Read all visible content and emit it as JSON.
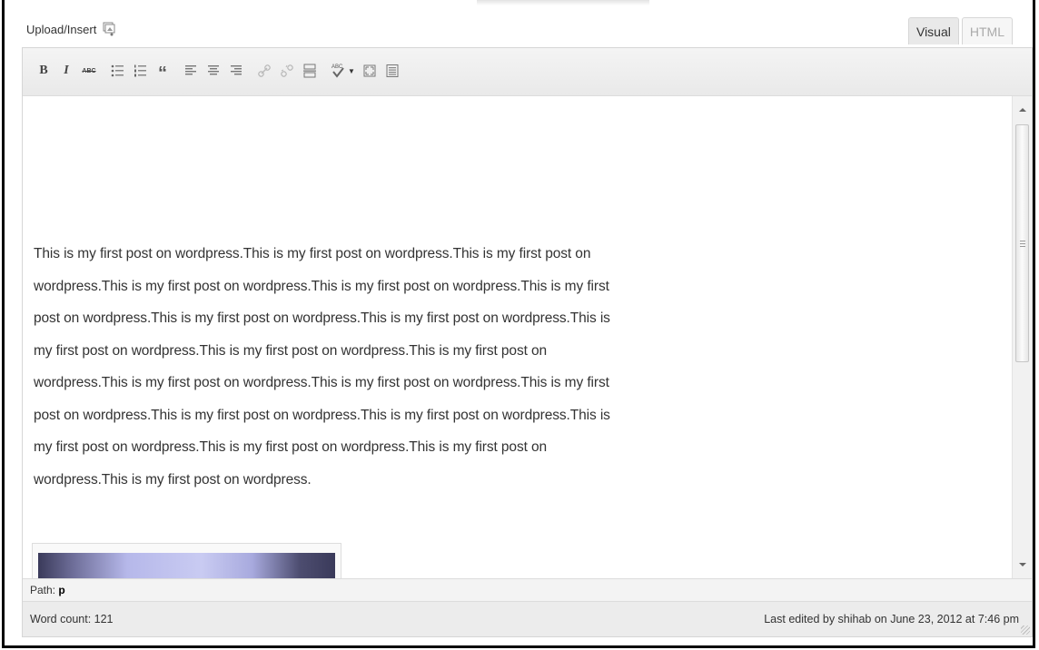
{
  "upload": {
    "label": "Upload/Insert",
    "icon": "media-gallery-icon"
  },
  "tabs": [
    {
      "label": "Visual",
      "active": true
    },
    {
      "label": "HTML",
      "active": false
    }
  ],
  "toolbar": {
    "buttons": [
      {
        "name": "bold-button",
        "label": "B"
      },
      {
        "name": "italic-button",
        "label": "I"
      },
      {
        "name": "strikethrough-button",
        "label": "ABC"
      },
      {
        "name": "bullet-list-button",
        "label": ""
      },
      {
        "name": "numbered-list-button",
        "label": ""
      },
      {
        "name": "blockquote-button",
        "label": "“"
      },
      {
        "name": "align-left-button",
        "label": ""
      },
      {
        "name": "align-center-button",
        "label": ""
      },
      {
        "name": "align-right-button",
        "label": ""
      },
      {
        "name": "insert-link-button",
        "label": ""
      },
      {
        "name": "unlink-button",
        "label": ""
      },
      {
        "name": "insert-more-tag-button",
        "label": ""
      },
      {
        "name": "spellcheck-button",
        "label": "ABC"
      },
      {
        "name": "fullscreen-button",
        "label": ""
      },
      {
        "name": "kitchen-sink-button",
        "label": ""
      }
    ]
  },
  "content": {
    "paragraph": "This is my first post on wordpress.This is my first post on wordpress.This is my first post on wordpress.This is my first post on wordpress.This is my first post on wordpress.This is my first post on wordpress.This is my first post on wordpress.This is my first post on wordpress.This is my first post on wordpress.This is my first post on wordpress.This is my first post on wordpress.This is my first post on wordpress.This is my first post on wordpress.This is my first post on wordpress.This is my first post on wordpress.This is my first post on wordpress.This is my first post on wordpress.This is my first post on wordpress.This is my first post on wordpress.This is my first post on wordpress."
  },
  "path": {
    "label": "Path:",
    "value": "p"
  },
  "status": {
    "word_count": "Word count: 121",
    "last_edited": "Last edited by shihab on June 23, 2012 at 7:46 pm"
  },
  "colors": {
    "text": "#333333",
    "toolbar": "#eeeeee",
    "border": "#d6d6d6"
  }
}
